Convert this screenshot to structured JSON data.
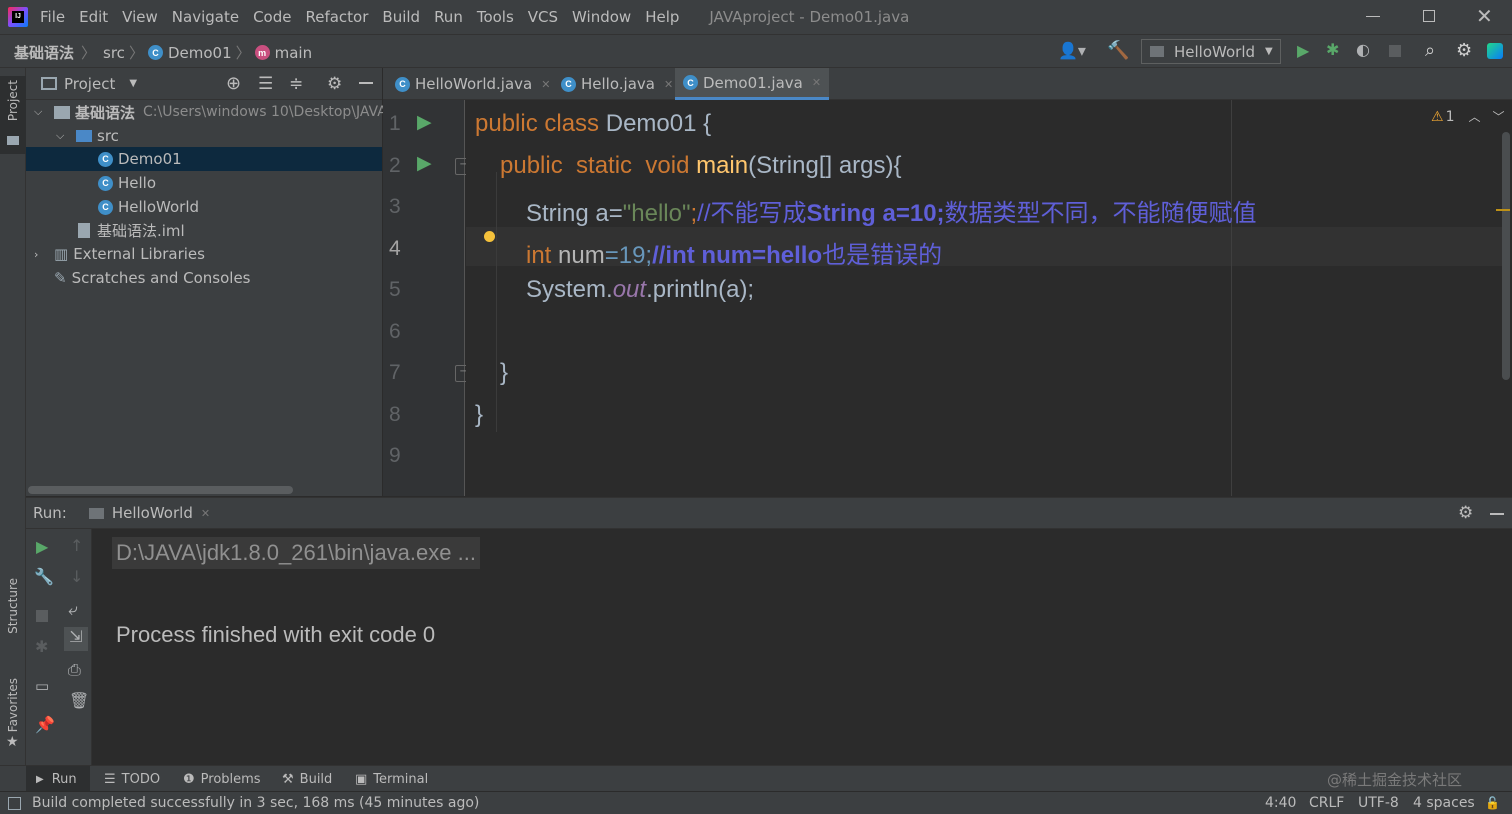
{
  "window": {
    "title": "JAVAproject - Demo01.java",
    "menu": [
      "File",
      "Edit",
      "View",
      "Navigate",
      "Code",
      "Refactor",
      "Build",
      "Run",
      "Tools",
      "VCS",
      "Window",
      "Help"
    ]
  },
  "breadcrumb": {
    "items": [
      "基础语法",
      "src",
      "Demo01",
      "main"
    ]
  },
  "toolbar": {
    "run_config": "HelloWorld"
  },
  "project_panel": {
    "title": "Project",
    "root_name": "基础语法",
    "root_path": "C:\\Users\\windows 10\\Desktop\\JAVA",
    "src": "src",
    "files": [
      "Demo01",
      "Hello",
      "HelloWorld"
    ],
    "iml": "基础语法.iml",
    "external": "External Libraries",
    "scratches": "Scratches and Consoles"
  },
  "side_labels": {
    "project": "Project",
    "structure": "Structure",
    "favorites": "Favorites"
  },
  "tabs": [
    "HelloWorld.java",
    "Hello.java",
    "Demo01.java"
  ],
  "editor": {
    "line_numbers": [
      "1",
      "2",
      "3",
      "4",
      "5",
      "6",
      "7",
      "8",
      "9"
    ],
    "warnings": "1",
    "lines": {
      "l1_kw": "public class ",
      "l1_name": "Demo01 {",
      "l2_kw": "public  static  void ",
      "l2_fn": "main",
      "l2_rest": "(String[] args){",
      "l3_a": "String a=",
      "l3_str": "\"hello\"",
      "l3_semi": ";",
      "l3_c1": "//不能写成",
      "l3_c2": "String a=10;",
      "l3_c3": "数据类型不同，不能随便赋值",
      "l4_kw": "int ",
      "l4_var": "num",
      "l4_rest": "=19;",
      "l4_c1": "//int num=hello",
      "l4_c2": "也是错误的",
      "l5_a": "System.",
      "l5_out": "out",
      "l5_rest": ".println(a);",
      "l7": "}",
      "l8": "}"
    }
  },
  "run_panel": {
    "label": "Run:",
    "tab": "HelloWorld",
    "cmd": "D:\\JAVA\\jdk1.8.0_261\\bin\\java.exe ...",
    "result": "Process finished with exit code 0"
  },
  "bottom_tabs": [
    "Run",
    "TODO",
    "Problems",
    "Build",
    "Terminal"
  ],
  "status": {
    "message": "Build completed successfully in 3 sec, 168 ms (45 minutes ago)",
    "position": "4:40",
    "line_sep": "CRLF",
    "encoding": "UTF-8",
    "indent": "4 spaces",
    "watermark": "@稀土掘金技术社区"
  },
  "colors": {
    "accent": "#4a88c7",
    "bg": "#2b2b2b",
    "panel": "#3c3f41",
    "keyword": "#cc7832",
    "string": "#6a8759",
    "comment": "#5f5fd8"
  }
}
